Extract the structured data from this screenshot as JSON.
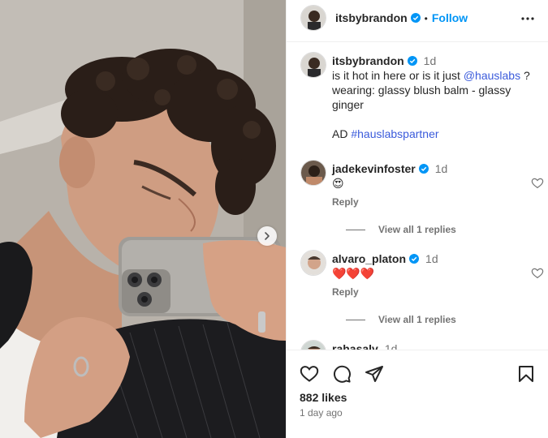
{
  "post": {
    "author": "itsbybrandon",
    "follow_label": "Follow",
    "separator": "•"
  },
  "caption": {
    "username": "itsbybrandon",
    "time": "1d",
    "text_before": "is it hot in here or is it just ",
    "mention": "@hauslabs",
    "text_after": " ? wearing: glassy blush balm - glassy ginger",
    "ad_prefix": "AD ",
    "hashtag": "#hauslabspartner"
  },
  "comments": [
    {
      "username": "jadekevinfoster",
      "time": "1d",
      "text": "😍",
      "reply_label": "Reply",
      "view_replies": "View all 1 replies"
    },
    {
      "username": "alvaro_platon",
      "time": "1d",
      "text": "❤️❤️❤️",
      "reply_label": "Reply",
      "view_replies": "View all 1 replies"
    },
    {
      "username": "rahasalv",
      "time": "1d"
    }
  ],
  "footer": {
    "likes": "882 likes",
    "posted": "1 day ago"
  },
  "colors": {
    "link": "#0095f6",
    "verified": "#0095f6",
    "secondary_text": "#737373"
  },
  "icons": [
    "more-icon",
    "verified-icon",
    "heart-icon",
    "comment-icon",
    "share-icon",
    "save-icon",
    "chevron-right-icon"
  ]
}
